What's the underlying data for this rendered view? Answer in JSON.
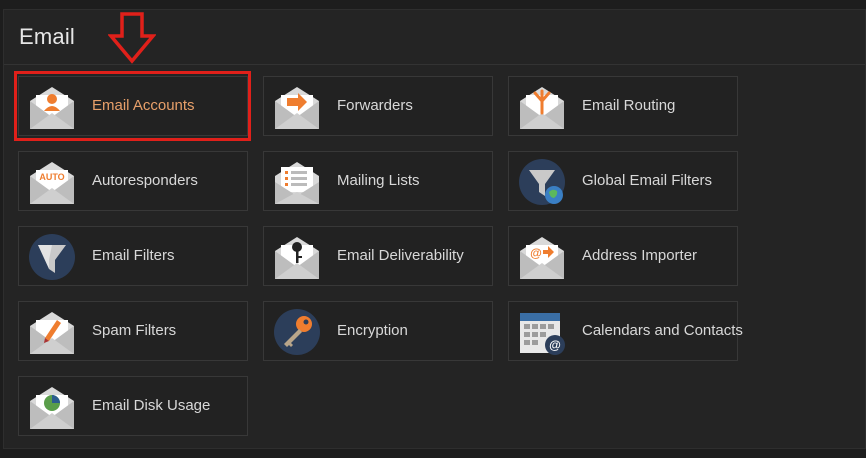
{
  "section": {
    "title": "Email"
  },
  "tiles": [
    {
      "label": "Email Accounts",
      "icon": "email-accounts-icon"
    },
    {
      "label": "Forwarders",
      "icon": "forwarders-icon"
    },
    {
      "label": "Email Routing",
      "icon": "email-routing-icon"
    },
    {
      "label": "Autoresponders",
      "icon": "autoresponders-icon",
      "icon_text": "AUTO"
    },
    {
      "label": "Mailing Lists",
      "icon": "mailing-lists-icon"
    },
    {
      "label": "Global Email Filters",
      "icon": "global-email-filters-icon"
    },
    {
      "label": "Email Filters",
      "icon": "email-filters-icon"
    },
    {
      "label": "Email Deliverability",
      "icon": "email-deliverability-icon"
    },
    {
      "label": "Address Importer",
      "icon": "address-importer-icon"
    },
    {
      "label": "Spam Filters",
      "icon": "spam-filters-icon"
    },
    {
      "label": "Encryption",
      "icon": "encryption-icon"
    },
    {
      "label": "Calendars and Contacts",
      "icon": "calendars-and-contacts-icon"
    },
    {
      "label": "Email Disk Usage",
      "icon": "email-disk-usage-icon"
    }
  ],
  "annotation": {
    "highlighted_tile": "Email Accounts",
    "color": "#e0201a"
  }
}
